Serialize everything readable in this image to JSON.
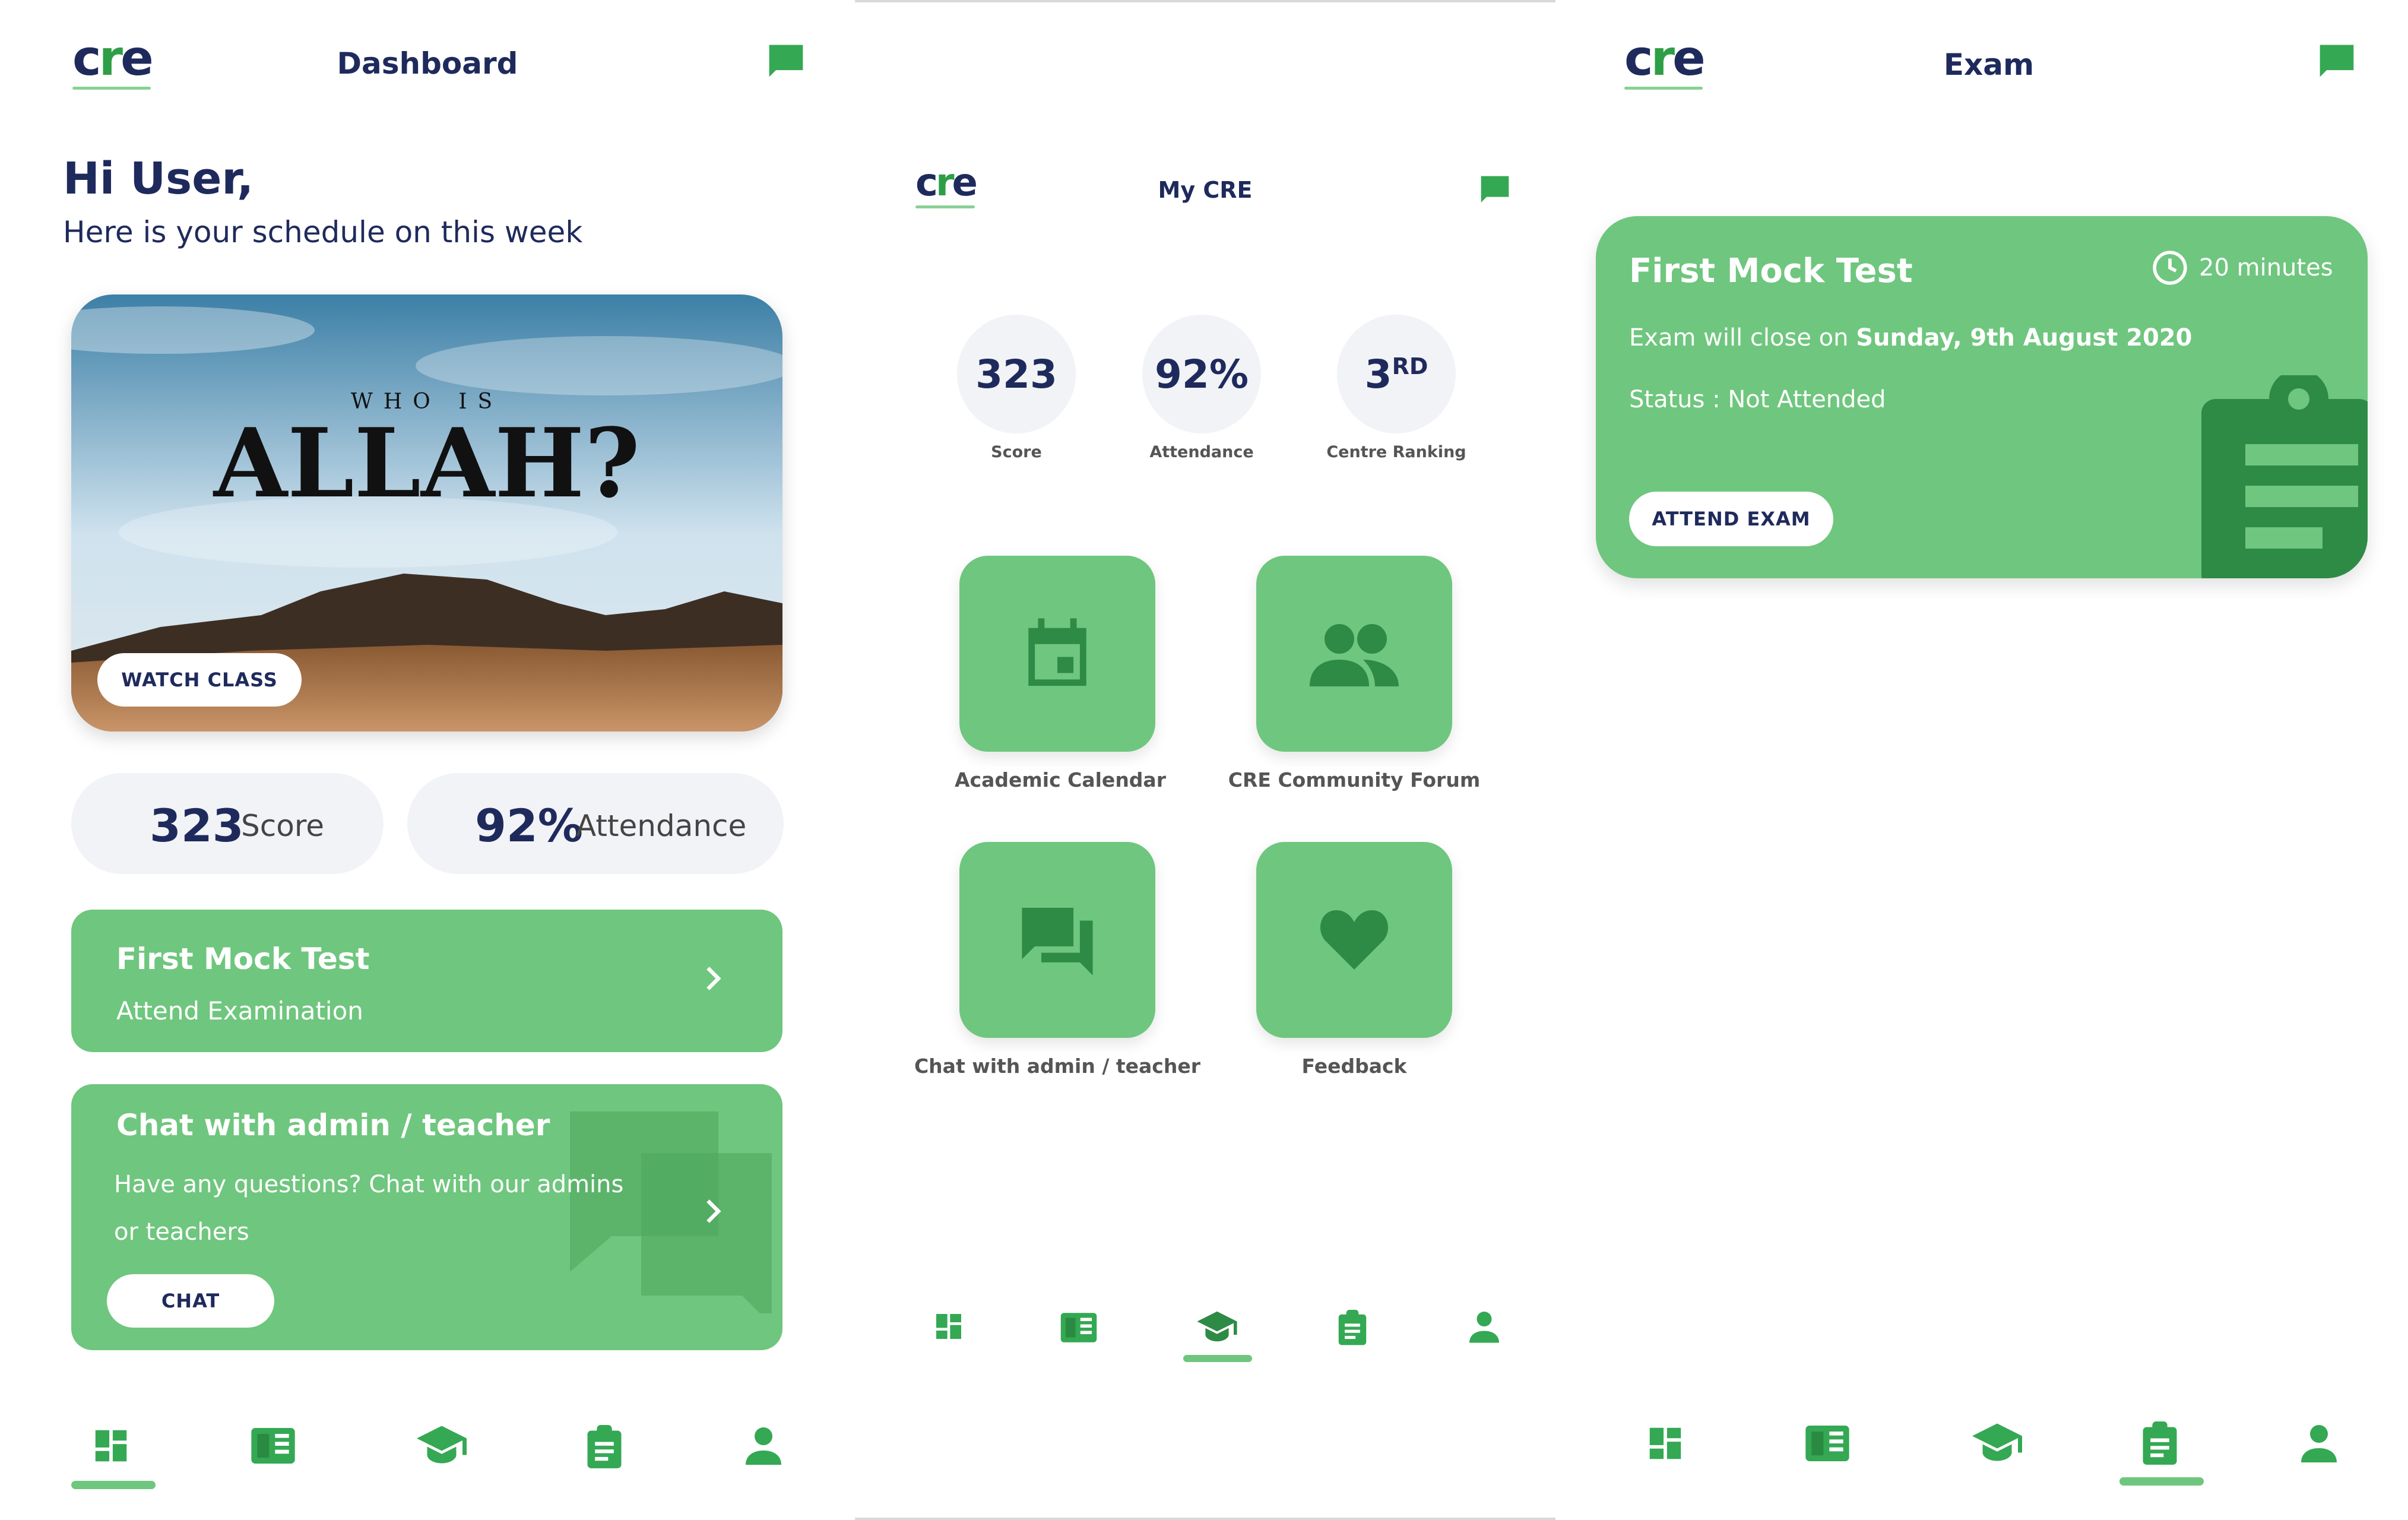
{
  "colors": {
    "primary_green": "#6fc67e",
    "dark_green": "#2e8b45",
    "navy": "#1f2a5c",
    "icon_green": "#34a853"
  },
  "brand": {
    "name_prefix": "c",
    "name_r": "r",
    "name_suffix": "e"
  },
  "dashboard": {
    "title": "Dashboard",
    "greeting": "Hi User,",
    "subtitle": "Here is your schedule on this week",
    "banner": {
      "small_text": "WHO IS",
      "big_text": "ALLAH?",
      "button": "WATCH CLASS"
    },
    "stats": [
      {
        "value": "323",
        "label": "Score"
      },
      {
        "value": "92%",
        "label": "Attendance"
      }
    ],
    "mock_card": {
      "title": "First Mock Test",
      "subtitle": "Attend Examination"
    },
    "chat_card": {
      "title": "Chat with admin / teacher",
      "line1": "Have any questions? Chat with our admins",
      "line2": "or teachers",
      "button": "CHAT"
    }
  },
  "mycre": {
    "title": "My CRE",
    "stats": [
      {
        "value": "323",
        "label": "Score"
      },
      {
        "value": "92%",
        "label": "Attendance"
      },
      {
        "value": "3",
        "sup": "RD",
        "label": "Centre Ranking"
      }
    ],
    "tiles": [
      {
        "label": "Academic Calendar",
        "icon": "calendar-icon"
      },
      {
        "label": "CRE Community Forum",
        "icon": "group-icon"
      },
      {
        "label": "Chat with admin / teacher",
        "icon": "forum-icon"
      },
      {
        "label": "Feedback",
        "icon": "heart-icon"
      }
    ]
  },
  "exam": {
    "title": "Exam",
    "card": {
      "title": "First Mock Test",
      "duration": "20 minutes",
      "close_prefix": "Exam will close on ",
      "close_date": "Sunday, 9th August 2020",
      "status": "Status : Not Attended",
      "button": "ATTEND EXAM"
    }
  },
  "nav": {
    "items": [
      "dashboard-icon",
      "book-icon",
      "school-icon",
      "clipboard-icon",
      "person-icon"
    ],
    "active": {
      "dashboard": 0,
      "mycre": 2,
      "exam": 3
    }
  }
}
